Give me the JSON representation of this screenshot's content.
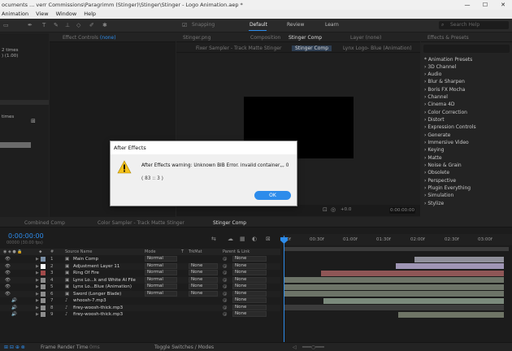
{
  "window": {
    "title": "ocuments ... verr Commissions\\Paragrimm (Stinger)\\Stinger\\Stinger - Logo Animation.aep *",
    "minimize": "—",
    "maximize": "☐",
    "close": "✕"
  },
  "menu": [
    "Animation",
    "View",
    "Window",
    "Help"
  ],
  "toolbar": {
    "snapping": "Snapping",
    "workspaces": [
      "Default",
      "Review",
      "Learn"
    ],
    "active_workspace": "Default",
    "search_placeholder": "Search Help"
  },
  "left_panel": {
    "line1": "2 times",
    "line2": ") (1.00)",
    "label": "times"
  },
  "effect_controls": {
    "tab_prefix": "Effect Controls",
    "tab_value": "(none)"
  },
  "composition": {
    "tabs": [
      "Stinger.png",
      "Composition",
      "Stinger Comp",
      "Layer (none)"
    ],
    "subtabs": [
      "Fixer Sampler - Track Matte Stinger",
      "Stinger Comp",
      "Lynx Logo- Blue (Animation)"
    ],
    "zoom": "+0.0",
    "timecode": "0:00:00:00"
  },
  "effects_panel": {
    "tab": "Effects & Presets",
    "items": [
      "* Animation Presets",
      "3D Channel",
      "Audio",
      "Blur & Sharpen",
      "Boris FX Mocha",
      "Channel",
      "Cinema 4D",
      "Color Correction",
      "Distort",
      "Expression Controls",
      "Generate",
      "Immersive Video",
      "Keying",
      "Matte",
      "Noise & Grain",
      "Obsolete",
      "Perspective",
      "Plugin Everything",
      "Simulation",
      "Stylize"
    ]
  },
  "timeline": {
    "tabs": [
      "Combined Comp",
      "Color Sampler - Track Matte Stinger",
      "Stinger Comp"
    ],
    "timecode": "0:00:00:00",
    "fps": "00000 (30.00 fps)",
    "columns": {
      "num": "#",
      "source": "Source Name",
      "mode": "Mode",
      "t": "T",
      "trkmat": "TrkMat",
      "parent": "Parent & Link"
    },
    "ruler": [
      "00f",
      "00:30f",
      "01:00f",
      "01:30f",
      "02:00f",
      "02:30f",
      "03:00f"
    ],
    "layers": [
      {
        "num": "1",
        "name": "Main Comp",
        "mode": "Normal",
        "trkmat": "",
        "parent": "None",
        "color": "#7a8fa6",
        "audio": false
      },
      {
        "num": "2",
        "name": "Adjustment Layer 11",
        "mode": "Normal",
        "trkmat": "None",
        "parent": "None",
        "color": "#ffffff",
        "audio": false
      },
      {
        "num": "3",
        "name": "Ring Of Fire",
        "mode": "Normal",
        "trkmat": "None",
        "parent": "None",
        "color": "#a24a4a",
        "audio": false
      },
      {
        "num": "4",
        "name": "Lynx Lo...k and White AI File",
        "mode": "Normal",
        "trkmat": "None",
        "parent": "None",
        "color": "#8d8d8d",
        "audio": false
      },
      {
        "num": "5",
        "name": "Lynx Lo...Blue (Animation)",
        "mode": "Normal",
        "trkmat": "None",
        "parent": "None",
        "color": "#8d8d8d",
        "audio": false
      },
      {
        "num": "6",
        "name": "Sword (Longer Blade)",
        "mode": "Normal",
        "trkmat": "None",
        "parent": "None",
        "color": "#8d8d8d",
        "audio": false
      },
      {
        "num": "7",
        "name": "whoosh-7.mp3",
        "mode": "",
        "trkmat": "",
        "parent": "None",
        "color": "#8d8d8d",
        "audio": true
      },
      {
        "num": "8",
        "name": "firey-woosh-thick.mp3",
        "mode": "",
        "trkmat": "",
        "parent": "None",
        "color": "#8d8d8d",
        "audio": true
      },
      {
        "num": "9",
        "name": "firey-woosh-thick.mp3",
        "mode": "",
        "trkmat": "",
        "parent": "None",
        "color": "#8d8d8d",
        "audio": true
      }
    ],
    "frame_render_label": "Frame Render Time",
    "frame_render_value": "0ms",
    "toggle_label": "Toggle Switches / Modes"
  },
  "dialog": {
    "title": "After Effects",
    "message": "After Effects warning: Unknown BIB Error. invalid container,,, 0",
    "code": "( 83 :: 3 )",
    "ok": "OK"
  }
}
